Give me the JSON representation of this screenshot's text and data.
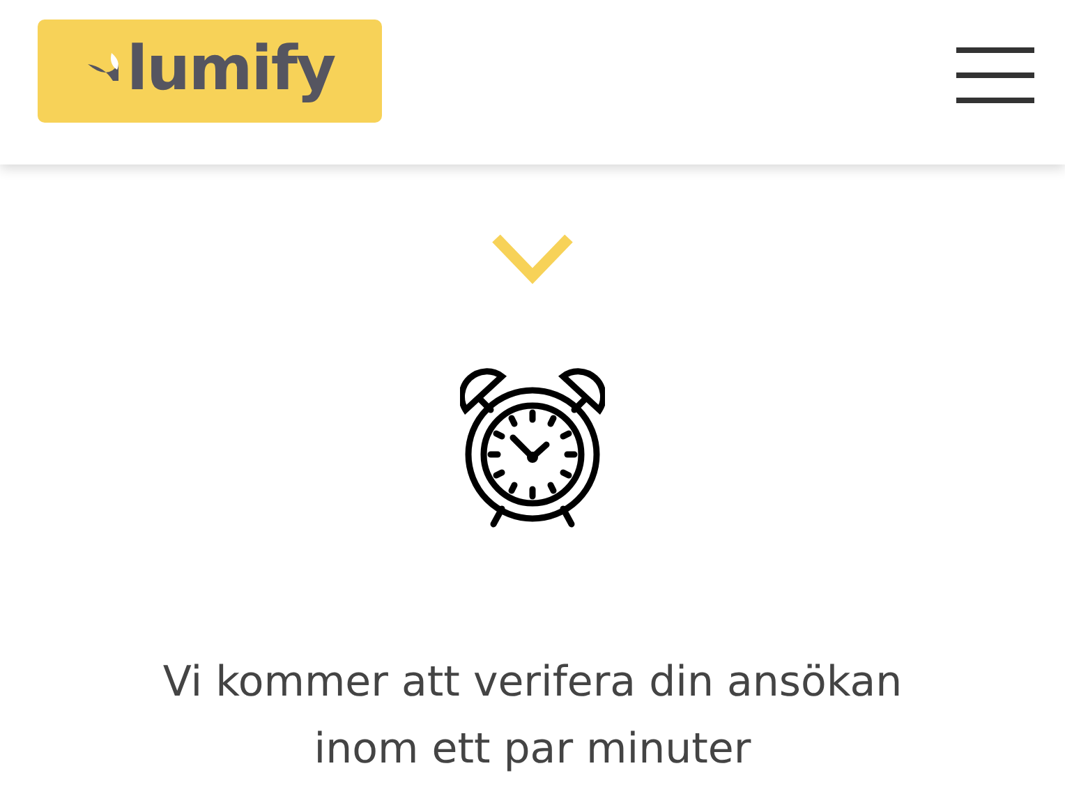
{
  "header": {
    "logo_text": "lumify"
  },
  "message": "Vi kommer att verifera din ansökan inom ett par minuter"
}
